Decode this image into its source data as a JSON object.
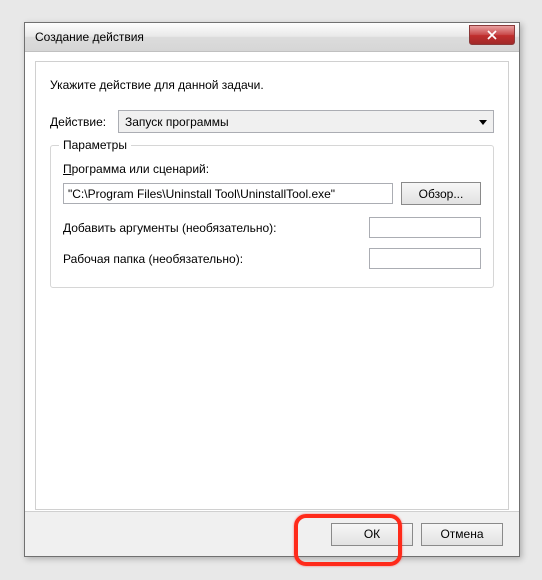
{
  "titlebar": {
    "title": "Создание действия"
  },
  "instruction": "Укажите действие для данной задачи.",
  "action": {
    "label_pre": "Д",
    "label_post": "ействие:",
    "selected": "Запуск программы"
  },
  "parameters": {
    "legend": "Параметры",
    "program_label_pre": "П",
    "program_label_post": "рограмма или сценарий:",
    "program_value": "\"C:\\Program Files\\Uninstall Tool\\UninstallTool.exe\"",
    "browse": "Обзор...",
    "arguments_label": "Добавить аргументы (необязательно):",
    "arguments_value": "",
    "workdir_label": "Рабочая папка (необязательно):",
    "workdir_value": ""
  },
  "footer": {
    "ok": "ОК",
    "cancel": "Отмена"
  }
}
